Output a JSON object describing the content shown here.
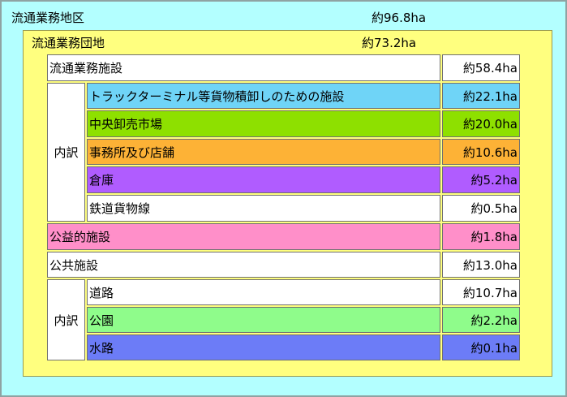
{
  "district": {
    "title": "流通業務地区",
    "area": "約96.8ha"
  },
  "estate": {
    "title": "流通業務団地",
    "area": "約73.2ha"
  },
  "facilities": {
    "logistics": {
      "label": "流通業務施設",
      "area": "約58.4ha"
    },
    "breakdown_label": "内訳",
    "logistics_items": [
      {
        "label": "トラックターミナル等貨物積卸しのための施設",
        "area": "約22.1ha",
        "color": "#6fd4f7"
      },
      {
        "label": "中央卸売市場",
        "area": "約20.0ha",
        "color": "#8ee000"
      },
      {
        "label": "事務所及び店舗",
        "area": "約10.6ha",
        "color": "#fdb236"
      },
      {
        "label": "倉庫",
        "area": "約5.2ha",
        "color": "#b05cff"
      },
      {
        "label": "鉄道貨物線",
        "area": "約0.5ha",
        "color": "#ffffff"
      }
    ],
    "public_benefit": {
      "label": "公益的施設",
      "area": "約1.8ha",
      "color": "#ff8fc9"
    },
    "public": {
      "label": "公共施設",
      "area": "約13.0ha"
    },
    "public_breakdown_label": "内訳",
    "public_items": [
      {
        "label": "道路",
        "area": "約10.7ha",
        "color": "#ffffff"
      },
      {
        "label": "公園",
        "area": "約2.2ha",
        "color": "#8ffc8b"
      },
      {
        "label": "水路",
        "area": "約0.1ha",
        "color": "#6c7cf7"
      }
    ]
  }
}
